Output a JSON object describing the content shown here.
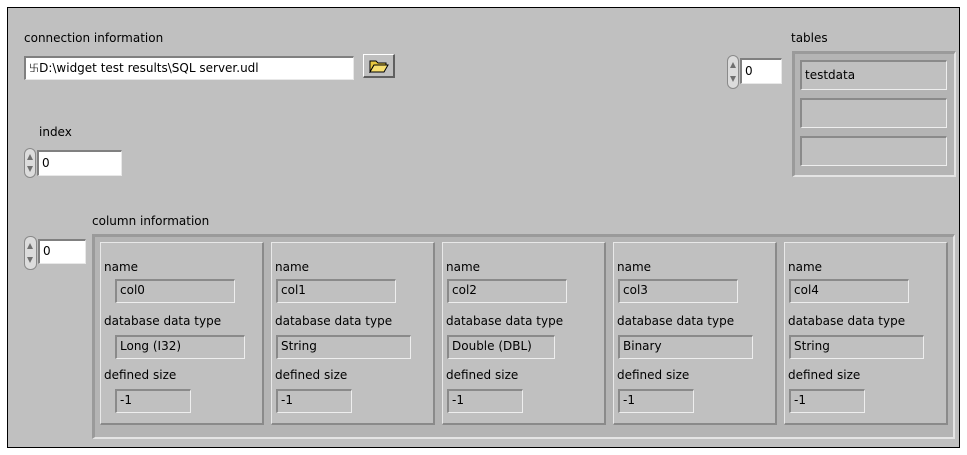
{
  "connection": {
    "label": "connection information",
    "path_prefix": "࿕",
    "path": "D:\\widget test results\\SQL server.udl"
  },
  "browse": {
    "icon": "folder-open-icon"
  },
  "index": {
    "label": "index",
    "value": "0"
  },
  "tables": {
    "label": "tables",
    "index": "0",
    "items": [
      "testdata",
      "",
      ""
    ]
  },
  "columns": {
    "label": "column information",
    "index": "0",
    "name_label": "name",
    "type_label": "database data type",
    "size_label": "defined size",
    "items": [
      {
        "name": "col0",
        "type": "Long (I32)",
        "size": "-1"
      },
      {
        "name": "col1",
        "type": "String",
        "size": "-1"
      },
      {
        "name": "col2",
        "type": "Double (DBL)",
        "size": "-1"
      },
      {
        "name": "col3",
        "type": "Binary",
        "size": "-1"
      },
      {
        "name": "col4",
        "type": "String",
        "size": "-1"
      }
    ]
  }
}
